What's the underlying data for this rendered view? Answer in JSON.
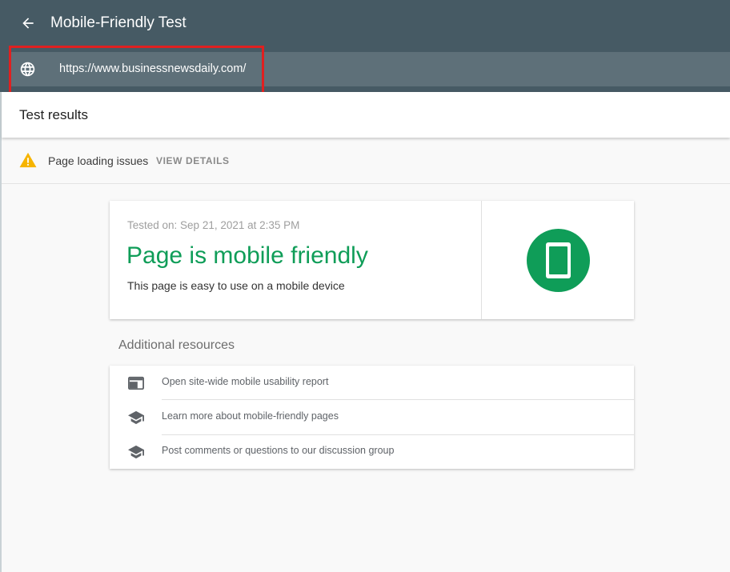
{
  "app": {
    "title": "Mobile-Friendly Test"
  },
  "url_bar": {
    "url": "https://www.businessnewsdaily.com/"
  },
  "results": {
    "title": "Test results"
  },
  "issues": {
    "text": "Page loading issues",
    "action": "VIEW DETAILS"
  },
  "result_card": {
    "tested_on": "Tested on: Sep 21, 2021 at 2:35 PM",
    "verdict": "Page is mobile friendly",
    "subtitle": "This page is easy to use on a mobile device"
  },
  "additional": {
    "title": "Additional resources",
    "items": [
      {
        "icon": "web-report-icon",
        "label": "Open site-wide mobile usability report"
      },
      {
        "icon": "school-icon",
        "label": "Learn more about mobile-friendly pages"
      },
      {
        "icon": "school-icon",
        "label": "Post comments or questions to our discussion group"
      }
    ]
  },
  "colors": {
    "appbar": "#465a64",
    "urlbar": "#5e7079",
    "success": "#0f9d58",
    "warning": "#f6b400",
    "highlight": "#e02020"
  }
}
